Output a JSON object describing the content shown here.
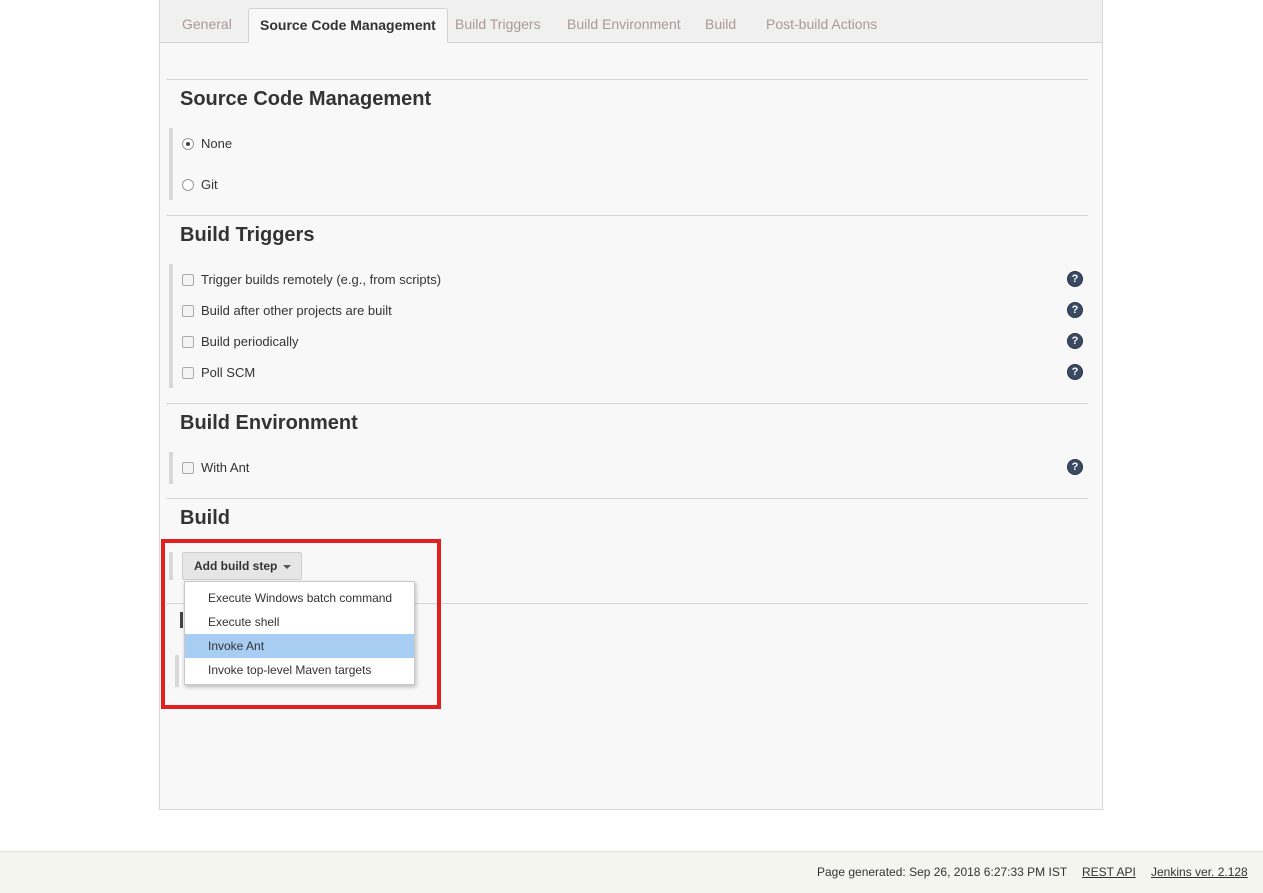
{
  "tabs": [
    {
      "label": "General"
    },
    {
      "label": "Source Code Management"
    },
    {
      "label": "Build Triggers"
    },
    {
      "label": "Build Environment"
    },
    {
      "label": "Build"
    },
    {
      "label": "Post-build Actions"
    }
  ],
  "scm": {
    "title": "Source Code Management",
    "options": [
      {
        "label": "None",
        "selected": true
      },
      {
        "label": "Git",
        "selected": false
      }
    ]
  },
  "triggers": {
    "title": "Build Triggers",
    "items": [
      {
        "label": "Trigger builds remotely (e.g., from scripts)",
        "checked": false
      },
      {
        "label": "Build after other projects are built",
        "checked": false
      },
      {
        "label": "Build periodically",
        "checked": false
      },
      {
        "label": "Poll SCM",
        "checked": false
      }
    ]
  },
  "environment": {
    "title": "Build Environment",
    "items": [
      {
        "label": "With Ant",
        "checked": false
      }
    ]
  },
  "build": {
    "title": "Build",
    "add_step_label": "Add build step",
    "menu": [
      {
        "label": "Execute Windows batch command",
        "highlighted": false
      },
      {
        "label": "Execute shell",
        "highlighted": false
      },
      {
        "label": "Invoke Ant",
        "highlighted": true
      },
      {
        "label": "Invoke top-level Maven targets",
        "highlighted": false
      }
    ]
  },
  "help_icon_glyph": "?",
  "footer": {
    "generated": "Page generated: Sep 26, 2018 6:27:33 PM IST",
    "rest_api": "REST API",
    "version": "Jenkins ver. 2.128"
  },
  "colors": {
    "highlight_box": "#e31f1f",
    "menu_highlight": "#a8cdf3",
    "help_icon": "#3a4a63"
  }
}
